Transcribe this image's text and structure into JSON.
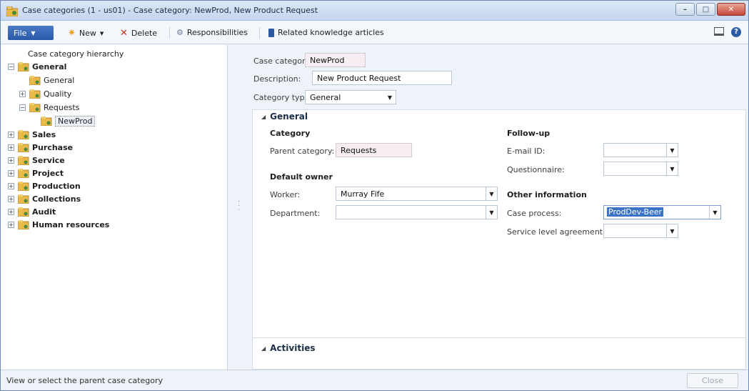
{
  "window": {
    "title": "Case categories (1 - us01) - Case category: NewProd, New Product Request",
    "minimize": "–",
    "maximize": "□",
    "close": "✕"
  },
  "toolbar": {
    "file_label": "File",
    "new_label": "New",
    "delete_label": "Delete",
    "responsibilities_label": "Responsibilities",
    "related_label": "Related knowledge articles"
  },
  "tree": {
    "header": "Case category hierarchy",
    "nodes": [
      {
        "label": "General",
        "bold": true
      },
      {
        "label": "General",
        "bold": false
      },
      {
        "label": "Quality",
        "bold": false
      },
      {
        "label": "Requests",
        "bold": false
      },
      {
        "label": "NewProd",
        "bold": false
      },
      {
        "label": "Sales",
        "bold": true
      },
      {
        "label": "Purchase",
        "bold": true
      },
      {
        "label": "Service",
        "bold": true
      },
      {
        "label": "Project",
        "bold": true
      },
      {
        "label": "Production",
        "bold": true
      },
      {
        "label": "Collections",
        "bold": true
      },
      {
        "label": "Audit",
        "bold": true
      },
      {
        "label": "Human resources",
        "bold": true
      }
    ]
  },
  "header_fields": {
    "case_category_label": "Case category:",
    "case_category_value": "NewProd",
    "description_label": "Description:",
    "description_value": "New Product Request",
    "category_type_label": "Category type:",
    "category_type_value": "General"
  },
  "general": {
    "title": "General",
    "category_group": "Category",
    "parent_category_label": "Parent category:",
    "parent_category_value": "Requests",
    "default_owner_group": "Default owner",
    "worker_label": "Worker:",
    "worker_value": "Murray Fife",
    "department_label": "Department:",
    "department_value": "",
    "followup_group": "Follow-up",
    "email_label": "E-mail ID:",
    "email_value": "",
    "questionnaire_label": "Questionnaire:",
    "questionnaire_value": "",
    "other_group": "Other information",
    "case_process_label": "Case process:",
    "case_process_value": "ProdDev-Beer",
    "sla_label": "Service level agreement:",
    "sla_value": ""
  },
  "activities": {
    "title": "Activities"
  },
  "status": {
    "text": "View or select the parent case category",
    "close_label": "Close"
  },
  "colors": {
    "accent": "#2a5aa8",
    "selection": "#3b73c7",
    "folder": "#e9b949"
  }
}
